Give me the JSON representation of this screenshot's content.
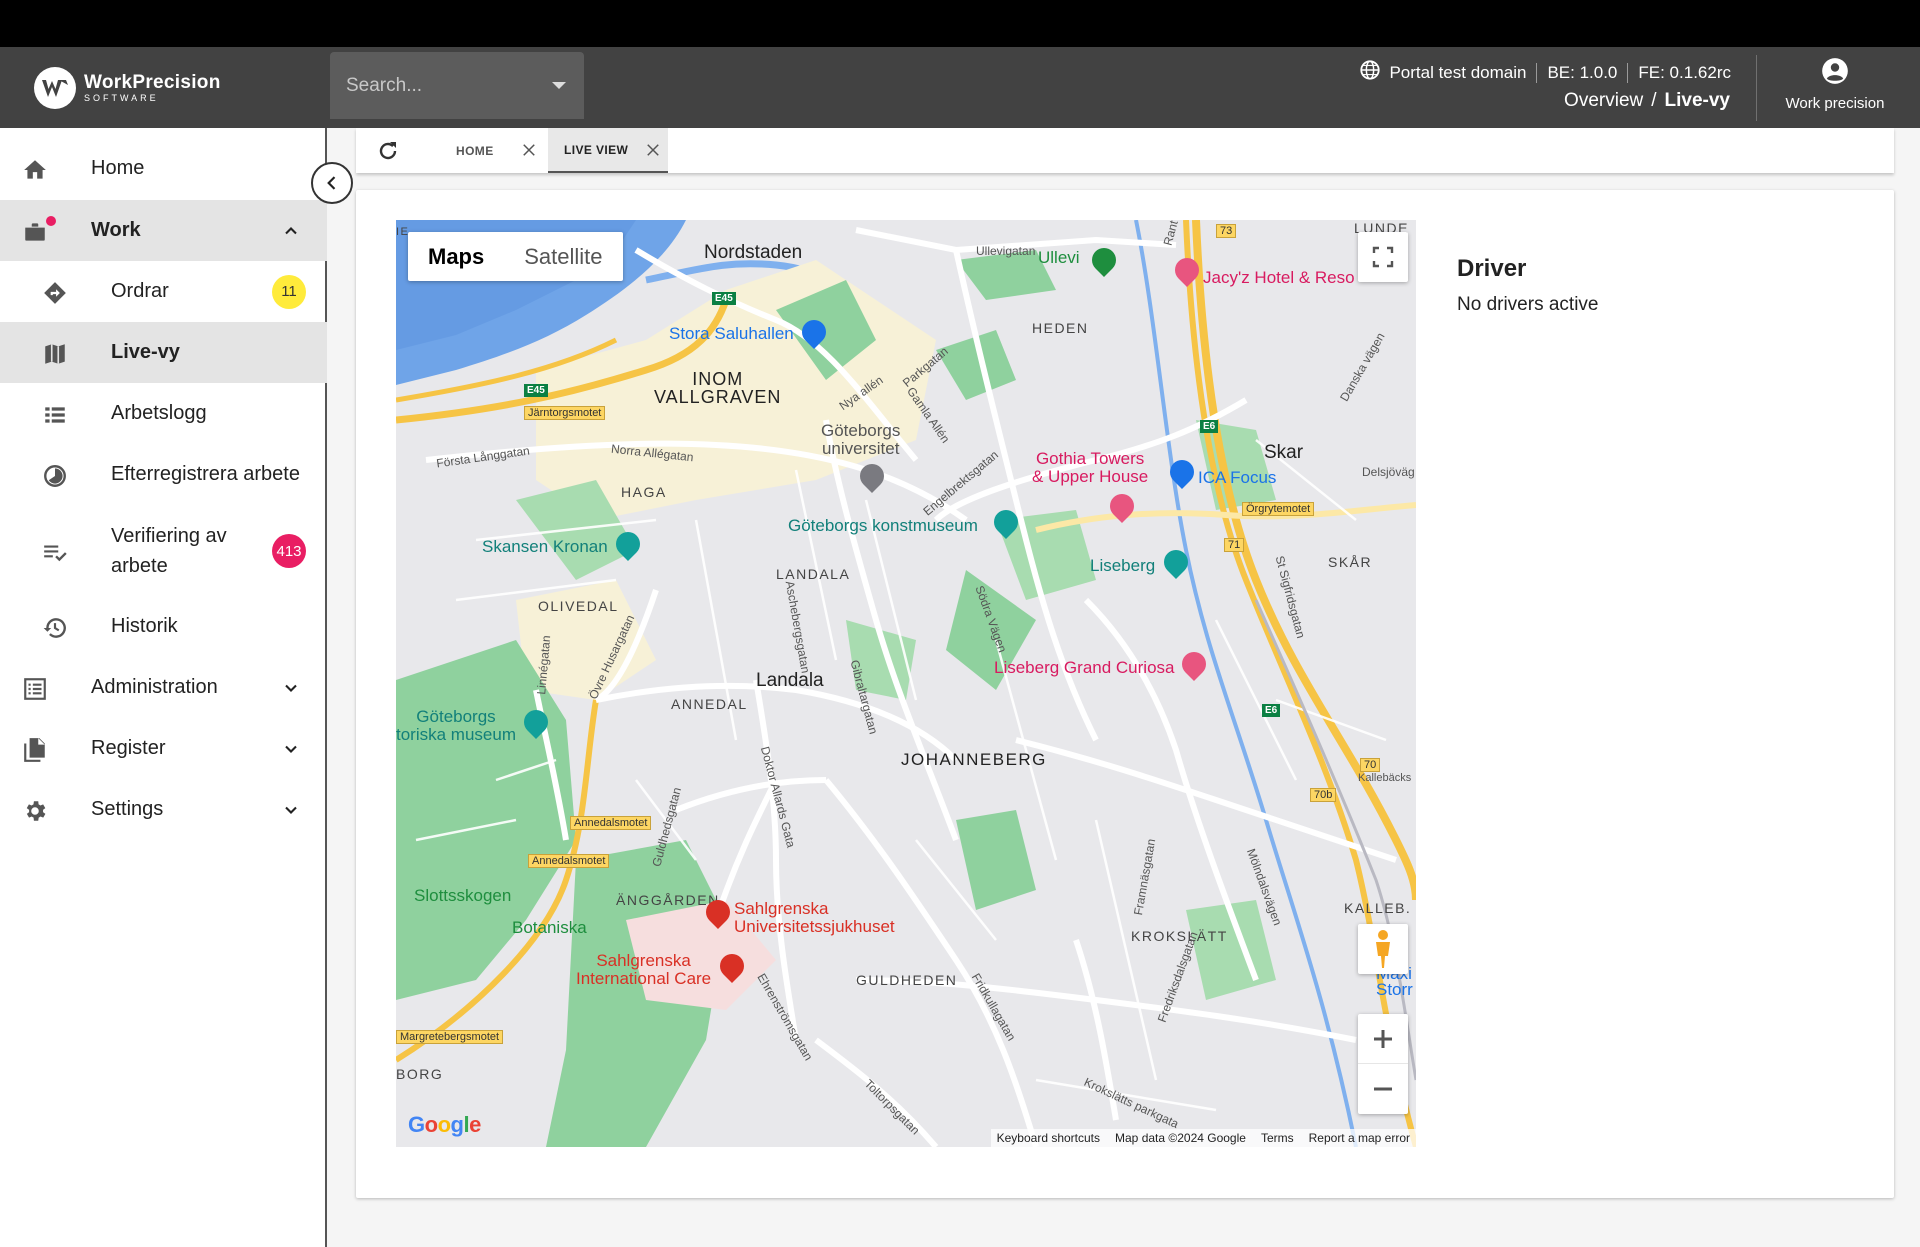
{
  "app": {
    "logo_main": "WorkPrecision",
    "logo_sub": "SOFTWARE",
    "search_placeholder": "Search...",
    "domain": "Portal test domain",
    "be_version": "BE: 1.0.0",
    "fe_version": "FE: 0.1.62rc",
    "breadcrumb": [
      "Overview",
      "Live-vy"
    ],
    "user": "Work precision"
  },
  "sidebar": {
    "items": [
      {
        "label": "Home",
        "icon": "home-icon"
      },
      {
        "label": "Work",
        "icon": "briefcase-icon",
        "expanded": true
      },
      {
        "label": "Ordrar",
        "icon": "direction-icon",
        "badge": "11"
      },
      {
        "label": "Live-vy",
        "icon": "map-icon",
        "active": true
      },
      {
        "label": "Arbetslogg",
        "icon": "list-icon"
      },
      {
        "label": "Efterregistrera arbete",
        "icon": "clock-pie-icon"
      },
      {
        "label": "Verifiering av arbete",
        "icon": "checklist-icon",
        "badge": "413"
      },
      {
        "label": "Historik",
        "icon": "history-icon"
      },
      {
        "label": "Administration",
        "icon": "document-list-icon"
      },
      {
        "label": "Register",
        "icon": "files-icon"
      },
      {
        "label": "Settings",
        "icon": "gear-icon"
      }
    ]
  },
  "tabs": [
    {
      "label": "HOME"
    },
    {
      "label": "LIVE VIEW",
      "active": true
    }
  ],
  "map": {
    "type_buttons": [
      "Maps",
      "Satellite"
    ],
    "selected_type": "Maps",
    "google": "Google",
    "attribution": [
      "Keyboard shortcuts",
      "Map data ©2024 Google",
      "Terms",
      "Report a map error"
    ],
    "labels": {
      "nordstaden": "Nordstaden",
      "ullevi": "Ullevi",
      "jacyz": "Jacy'z Hotel & Reso",
      "heden": "HEDEN",
      "lunde": "LUNDE",
      "stora_saluhallen": "Stora Saluhallen",
      "inom_vallgraven": "INOM\nVALLGRAVEN",
      "gu": "Göteborgs\nuniversitet",
      "gothia": "Gothia Towers\n& Upper House",
      "ica": "ICA Focus",
      "skar": "Skar",
      "haga": "HAGA",
      "skansen": "Skansen Kronan",
      "konstmuseum": "Göteborgs konstmuseum",
      "liseberg": "Liseberg",
      "skar_district": "SKÅR",
      "landala_d": "LANDALA",
      "olivedal": "OLIVEDAL",
      "curiosa": "Liseberg Grand Curiosa",
      "landala": "Landala",
      "annedal": "ANNEDAL",
      "gbg_museum": "Göteborgs\ntoriska museum",
      "johanneberg": "JOHANNEBERG",
      "slottsskogen": "Slottsskogen",
      "botaniska": "Botaniska",
      "anggarden": "ÄNGGÅRDEN",
      "sahlgrenska": "Sahlgrenska\nUniversitetssjukhuset",
      "sahlgrenska_int": "Sahlgrenska\nInternational Care",
      "guldheden": "GULDHEDEN",
      "krokslatt": "KROKSLÄTT",
      "kalleb": "KALLEB.",
      "maxi": "Maxi\nStorr",
      "borg": "BORG",
      "forsta_langgatan": "Första Långgatan",
      "norra_allegatan": "Norra Allégatan",
      "ullevigatan": "Ullevigatan",
      "nya_allen": "Nya allén",
      "parkgatan": "Parkgatan",
      "gamla_allen": "Gamla Allén",
      "engelbrektsgatan": "Engelbrektsgatan",
      "linnegatan": "Linnégatan",
      "ovre_husargatan": "Övre Husargatan",
      "aschebergsgatan": "Aschebergsgatan",
      "gibraltargatan": "Gibraltargatan",
      "sodra_vagen": "Södra Vägen",
      "doktor_allards": "Doktor Allards Gata",
      "guldhedsgatan": "Guldhedsgatan",
      "ehrenstromsgatan": "Ehrenströmsgatan",
      "toltorpsgatan": "Toltorpsgatan",
      "framnasgatan": "Framnäsgatan",
      "fridkullagatan": "Fridkullagatan",
      "fredriksdalsgatan": "Fredriksdalsgatan",
      "molndalsvagen": "Mölndalsvägen",
      "sigfridsgatan": "St Sigfridsgatan",
      "danska_vagen": "Danska vägen",
      "krokslatts_parkgata": "Krokslätts parkgata",
      "delsjovag": "Delsjöväg",
      "kallebacks": "Kallebäcks",
      "rant": "Rant",
      "e45a": "E45",
      "e45b": "E45",
      "e6a": "E6",
      "e6b": "E6",
      "jarntorgsmotet": "Järntorgsmotet",
      "orgrytemotet": "Örgrytemotet",
      "annedalsmotet1": "Annedalsmotet",
      "annedalsmotet2": "Annedalsmotet",
      "margretebergsmotet": "Margretebergsmotet",
      "r73": "73",
      "r71": "71",
      "r70": "70",
      "r70b": "70b",
      "ie": "IE"
    }
  },
  "driver": {
    "title": "Driver",
    "status": "No drivers active"
  },
  "colors": {
    "appbar": "#424242",
    "badge_yellow": "#ffeb3b",
    "badge_red": "#e91e63",
    "water": "#6fa4e8",
    "park": "#8fd19e",
    "highway": "#f6c445"
  }
}
